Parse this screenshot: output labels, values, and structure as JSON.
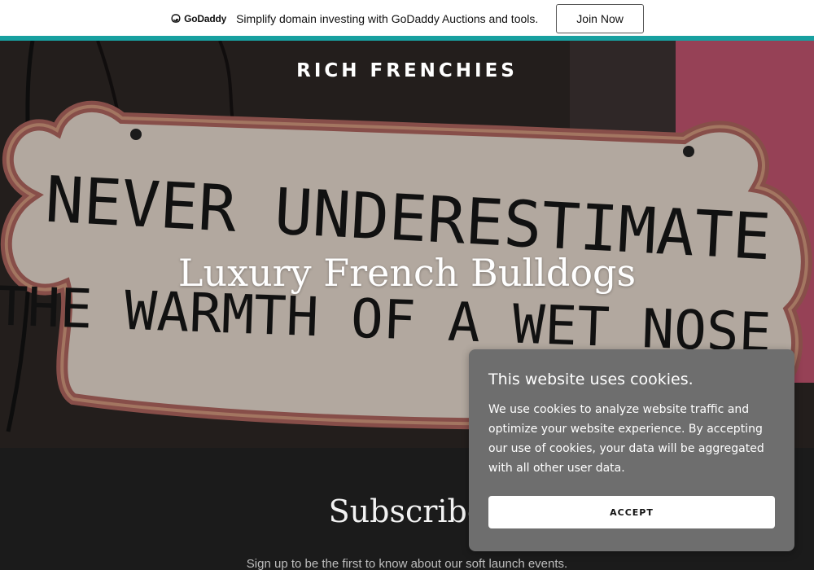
{
  "promo": {
    "logo_text": "GoDaddy",
    "message": "Simplify domain investing with GoDaddy Auctions and tools.",
    "button_label": "Join Now",
    "accent_color": "#18a0a0"
  },
  "hero": {
    "site_title": "RICH FRENCHIES",
    "heading": "Luxury French Bulldogs",
    "sign_line1": "NEVER UNDERESTIMATE",
    "sign_line2": "THE WARMTH OF A WET NOSE"
  },
  "subscribe": {
    "title": "Subscribe",
    "subtitle": "Sign up to be the first to know about our soft launch events."
  },
  "cookie": {
    "title": "This website uses cookies.",
    "body": "We use cookies to analyze website traffic and optimize your website experience. By accepting our use of cookies, your data will be aggregated with all other user data.",
    "accept_label": "ACCEPT"
  }
}
